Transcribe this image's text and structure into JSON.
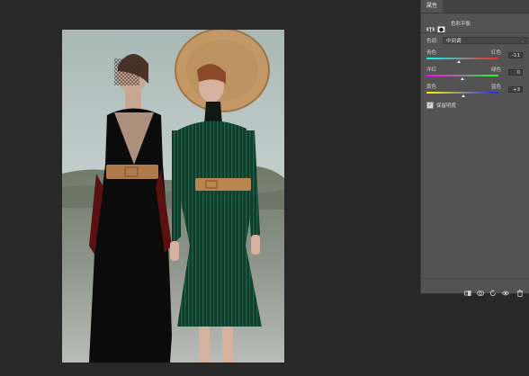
{
  "panel": {
    "tab": "属性",
    "header_label": "色彩平衡",
    "header_icons": [
      "balance-scale-icon",
      "layer-mask-icon"
    ],
    "tone": {
      "label": "色调:",
      "value": "中间调"
    },
    "sliders": [
      {
        "left": "青色",
        "right": "红色",
        "value": "-11",
        "level": -11
      },
      {
        "left": "洋红",
        "right": "绿色",
        "value": "0",
        "level": 0
      },
      {
        "left": "黄色",
        "right": "蓝色",
        "value": "+3",
        "level": 3
      }
    ],
    "preserve_luminosity": {
      "label": "保留明度",
      "checked": true
    },
    "bottom_icons": [
      "clip-to-layer-icon",
      "view-previous-icon",
      "reset-icon",
      "visibility-icon",
      "trash-icon"
    ]
  }
}
